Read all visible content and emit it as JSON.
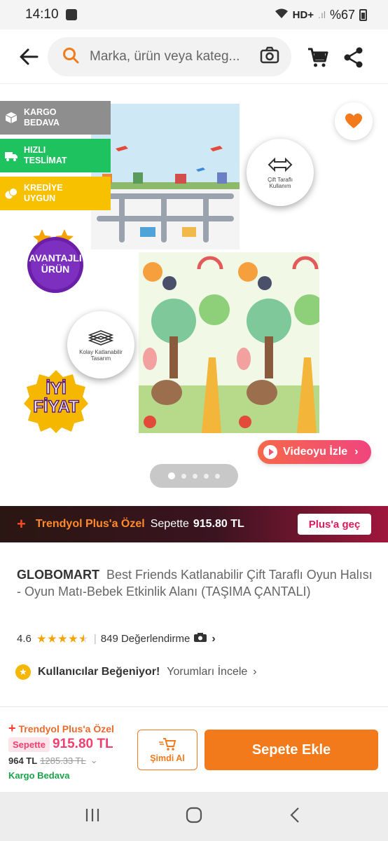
{
  "status": {
    "time": "14:10",
    "network": "HD+",
    "battery": "%67"
  },
  "header": {
    "search_placeholder": "Marka, ürün veya kateg..."
  },
  "gallery": {
    "badges": [
      {
        "label": "KARGO BEDAVA",
        "color": "#8e8e8e"
      },
      {
        "label": "HIZLI TESLİMAT",
        "color": "#1ec25f"
      },
      {
        "label": "KREDİYE UYGUN",
        "color": "#f7c100"
      }
    ],
    "sticker_avantaj": [
      "AVANTAJLI",
      "ÜRÜN"
    ],
    "sticker_iyi": [
      "İYİ",
      "FİYAT"
    ],
    "seal_twoside": "Çift Taraflı Kullanım",
    "seal_fold": "Kolay Katlanabilir Tasarım",
    "video_label": "Videoyu İzle",
    "carousel": {
      "count": 5,
      "active": 1
    }
  },
  "plus_banner": {
    "label": "Trendyol Plus'a Özel",
    "sepette": "Sepette",
    "price": "915.80 TL",
    "cta": "Plus'a geç"
  },
  "product": {
    "brand": "GLOBOMART",
    "name": "Best Friends Katlanabilir Çift Taraflı Oyun Halısı - Oyun Matı-Bebek Etkinlik Alanı (TAŞIMA ÇANTALI)",
    "rating": "4.6",
    "review_count": "849 Değerlendirme",
    "liked_label": "Kullanıcılar Beğeniyor!",
    "reviews_link": "Yorumları İncele"
  },
  "action_bar": {
    "plus_label": "Trendyol Plus'a Özel",
    "sepette": "Sepette",
    "sepette_price": "915.80 TL",
    "price_now": "964 TL",
    "price_old": "1285.33 TL",
    "shipping": "Kargo Bedava",
    "buy_now": "Şimdi Al",
    "add_to_cart": "Sepete Ekle"
  },
  "colors": {
    "brand_orange": "#f27a1a",
    "plus_pink": "#f0406f",
    "green": "#1aa34a"
  }
}
